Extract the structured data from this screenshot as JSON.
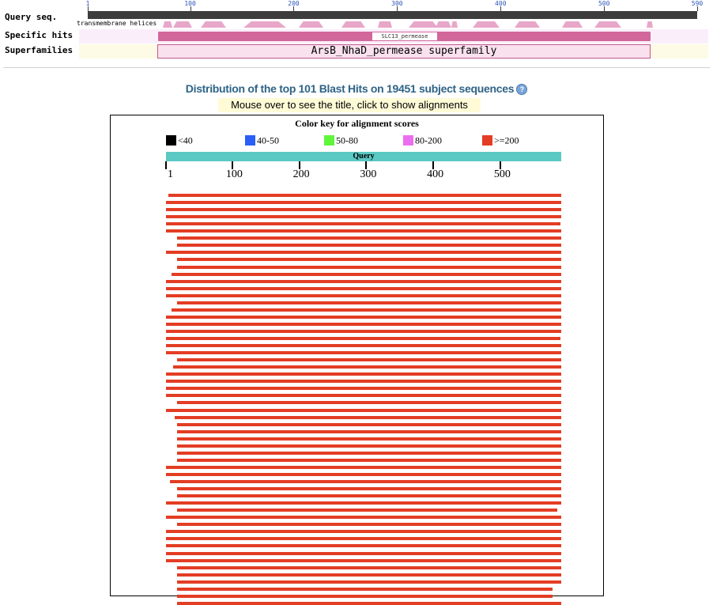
{
  "cdd": {
    "query_label": "Query seq.",
    "specific_label": "Specific hits",
    "superfamilies_label": "Superfamilies",
    "tm_label": "transmembrane helices",
    "ruler_ticks": [
      "1",
      "100",
      "200",
      "300",
      "400",
      "500",
      "590"
    ],
    "specific_hit": "SLC13_permease",
    "superfamily_hit": "ArsB_NhaD_permease superfamily"
  },
  "blast": {
    "title": "Distribution of the top 101 Blast Hits on 19451 subject sequences",
    "help_icon": "help-icon",
    "hint": "Mouse over to see the title, click to show alignments",
    "color_key_title": "Color key for alignment scores",
    "color_key": [
      {
        "label": "<40",
        "color": "#000000"
      },
      {
        "label": "40-50",
        "color": "#2a5ef5"
      },
      {
        "label": "50-80",
        "color": "#5ff53b"
      },
      {
        "label": "80-200",
        "color": "#eb6ef0"
      },
      {
        "label": ">=200",
        "color": "#e33d24"
      }
    ],
    "query_label": "Query",
    "query_ticks": [
      "1",
      "100",
      "200",
      "300",
      "400",
      "500"
    ],
    "query_length": 590,
    "hits_shown": 57,
    "hit_color": "#e33d24",
    "hit_spans": [
      [
        5,
        590
      ],
      [
        1,
        590
      ],
      [
        1,
        590
      ],
      [
        1,
        590
      ],
      [
        1,
        589
      ],
      [
        1,
        590
      ],
      [
        18,
        590
      ],
      [
        18,
        590
      ],
      [
        1,
        590
      ],
      [
        18,
        590
      ],
      [
        18,
        590
      ],
      [
        9,
        590
      ],
      [
        1,
        590
      ],
      [
        1,
        590
      ],
      [
        1,
        590
      ],
      [
        18,
        590
      ],
      [
        9,
        590
      ],
      [
        1,
        590
      ],
      [
        1,
        590
      ],
      [
        1,
        590
      ],
      [
        1,
        589
      ],
      [
        1,
        590
      ],
      [
        1,
        590
      ],
      [
        18,
        590
      ],
      [
        12,
        590
      ],
      [
        1,
        590
      ],
      [
        1,
        590
      ],
      [
        1,
        590
      ],
      [
        1,
        590
      ],
      [
        18,
        590
      ],
      [
        1,
        590
      ],
      [
        14,
        590
      ],
      [
        18,
        590
      ],
      [
        18,
        590
      ],
      [
        18,
        590
      ],
      [
        18,
        590
      ],
      [
        18,
        590
      ],
      [
        18,
        590
      ],
      [
        1,
        590
      ],
      [
        1,
        590
      ],
      [
        7,
        590
      ],
      [
        18,
        590
      ],
      [
        18,
        590
      ],
      [
        1,
        590
      ],
      [
        18,
        584
      ],
      [
        1,
        590
      ],
      [
        18,
        590
      ],
      [
        1,
        590
      ],
      [
        1,
        590
      ],
      [
        1,
        590
      ],
      [
        1,
        590
      ],
      [
        1,
        590
      ],
      [
        18,
        590
      ],
      [
        18,
        590
      ],
      [
        18,
        590
      ],
      [
        18,
        577
      ],
      [
        18,
        577
      ],
      [
        18,
        590
      ]
    ]
  }
}
